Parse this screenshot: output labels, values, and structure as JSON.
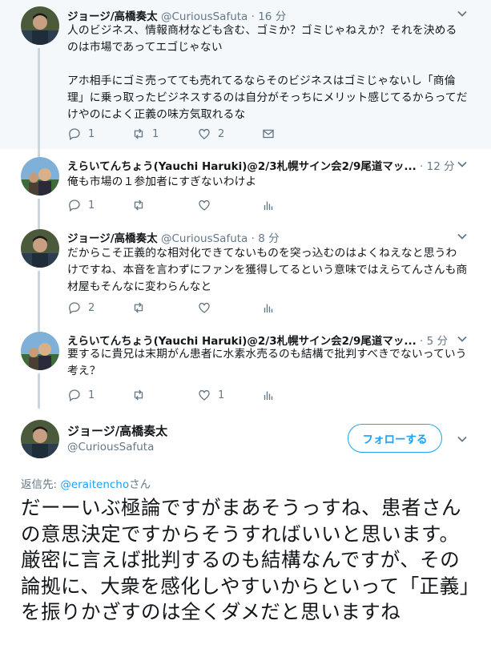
{
  "tweets": [
    {
      "name": "ジョージ/高橋奏太",
      "handle": "@CuriousSafuta",
      "time": "16 分",
      "text": "人のビジネス、情報商材なども含む、ゴミか？ゴミじゃねえか？それを決めるのは市場であってエゴじゃない\n\nアホ相手にゴミ売ってても売れてるならそのビジネスはゴミじゃないし「商倫理」に乗っ取ったビジネスするのは自分がそっちにメリット感じてるからってだけやのによく正義の味方気取れるな",
      "replies": "1",
      "retweets": "1",
      "likes": "2"
    },
    {
      "name": "えらいてんちょう(Yauchi Haruki)@2/3札幌サイン会2/9尾道マッ...",
      "handle": "",
      "time": "12 分",
      "text": "俺も市場の１参加者にすぎないわけよ",
      "replies": "1",
      "retweets": "",
      "likes": ""
    },
    {
      "name": "ジョージ/高橋奏太",
      "handle": "@CuriousSafuta",
      "time": "8 分",
      "text": "だからこそ正義的な相対化できてないものを突っ込むのはよくねえなと思うわけですね、本音を言わずにファンを獲得してるという意味ではえらてんさんも商材屋もそんなに変わらんなと",
      "replies": "2",
      "retweets": "",
      "likes": ""
    },
    {
      "name": "えらいてんちょう(Yauchi Haruki)@2/3札幌サイン会2/9尾道マッ...",
      "handle": "",
      "time": "5 分",
      "text": "要するに貴兄は末期がん患者に水素水売るのも結構で批判すべきでないっていう考え？",
      "replies": "1",
      "retweets": "",
      "likes": "1"
    }
  ],
  "main_tweet": {
    "name": "ジョージ/高橋奏太",
    "handle": "@CuriousSafuta",
    "follow_label": "フォローする",
    "reply_prefix": "返信先: ",
    "reply_link": "@eraitencho",
    "reply_suffix": "さん",
    "text": "だーーいぶ極論ですがまあそうっすね、患者さんの意思決定ですからそうすればいいと思います。厳密に言えば批判するのも結構なんですが、その論拠に、大衆を感化しやすいからといって「正義」を振りかざすのは全くダメだと思いますね"
  },
  "colors": {
    "accent": "#1da1f2",
    "secondary_text": "#657786",
    "highlight_bg": "#f5f8fa"
  },
  "icons": [
    "reply-icon",
    "retweet-icon",
    "like-icon",
    "dm-icon",
    "analytics-icon",
    "chevron-down-icon"
  ]
}
